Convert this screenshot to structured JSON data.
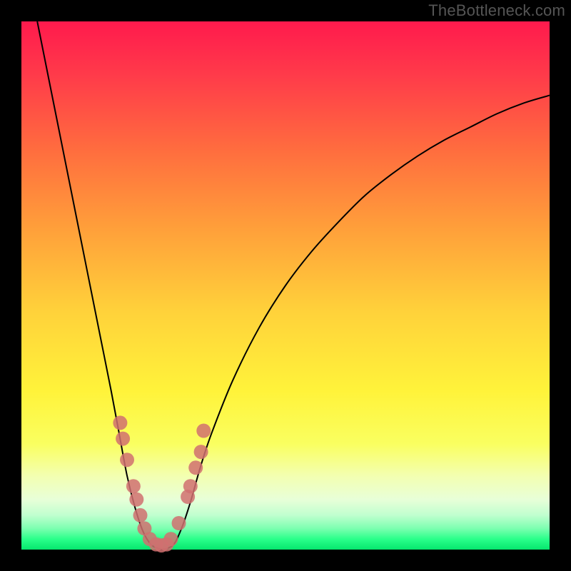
{
  "watermark": "TheBottleneck.com",
  "chart_data": {
    "type": "line",
    "title": "",
    "xlabel": "",
    "ylabel": "",
    "xlim": [
      0,
      100
    ],
    "ylim": [
      0,
      100
    ],
    "background_gradient": {
      "stops": [
        {
          "offset": 0.0,
          "color": "#ff1a4d"
        },
        {
          "offset": 0.1,
          "color": "#ff3a4a"
        },
        {
          "offset": 0.25,
          "color": "#ff6f3e"
        },
        {
          "offset": 0.4,
          "color": "#ffa23a"
        },
        {
          "offset": 0.55,
          "color": "#ffd23a"
        },
        {
          "offset": 0.7,
          "color": "#fff33a"
        },
        {
          "offset": 0.8,
          "color": "#faff60"
        },
        {
          "offset": 0.86,
          "color": "#f3ffb0"
        },
        {
          "offset": 0.905,
          "color": "#e8ffd8"
        },
        {
          "offset": 0.935,
          "color": "#c0ffcf"
        },
        {
          "offset": 0.96,
          "color": "#7cffb0"
        },
        {
          "offset": 0.98,
          "color": "#2aff8a"
        },
        {
          "offset": 1.0,
          "color": "#06e66e"
        }
      ]
    },
    "series": [
      {
        "name": "bottleneck-curve",
        "type": "line",
        "color": "#000000",
        "width": 2,
        "points": [
          {
            "x": 3.0,
            "y": 100.0
          },
          {
            "x": 5.0,
            "y": 90.0
          },
          {
            "x": 7.0,
            "y": 80.0
          },
          {
            "x": 9.0,
            "y": 70.0
          },
          {
            "x": 11.0,
            "y": 60.0
          },
          {
            "x": 13.0,
            "y": 50.0
          },
          {
            "x": 15.0,
            "y": 40.0
          },
          {
            "x": 17.0,
            "y": 30.0
          },
          {
            "x": 18.5,
            "y": 22.0
          },
          {
            "x": 20.0,
            "y": 14.0
          },
          {
            "x": 21.5,
            "y": 8.0
          },
          {
            "x": 23.0,
            "y": 3.5
          },
          {
            "x": 24.5,
            "y": 1.0
          },
          {
            "x": 26.0,
            "y": 0.2
          },
          {
            "x": 27.5,
            "y": 0.2
          },
          {
            "x": 29.0,
            "y": 1.2
          },
          {
            "x": 30.5,
            "y": 4.5
          },
          {
            "x": 32.0,
            "y": 9.0
          },
          {
            "x": 34.0,
            "y": 16.0
          },
          {
            "x": 36.0,
            "y": 22.0
          },
          {
            "x": 40.0,
            "y": 32.0
          },
          {
            "x": 45.0,
            "y": 42.0
          },
          {
            "x": 50.0,
            "y": 50.0
          },
          {
            "x": 55.0,
            "y": 56.5
          },
          {
            "x": 60.0,
            "y": 62.0
          },
          {
            "x": 65.0,
            "y": 67.0
          },
          {
            "x": 70.0,
            "y": 71.0
          },
          {
            "x": 75.0,
            "y": 74.5
          },
          {
            "x": 80.0,
            "y": 77.5
          },
          {
            "x": 85.0,
            "y": 80.0
          },
          {
            "x": 90.0,
            "y": 82.5
          },
          {
            "x": 95.0,
            "y": 84.5
          },
          {
            "x": 100.0,
            "y": 86.0
          }
        ]
      },
      {
        "name": "highlighted-points",
        "type": "scatter",
        "color": "#d07070",
        "radius": 10,
        "points": [
          {
            "x": 18.7,
            "y": 24.0
          },
          {
            "x": 19.2,
            "y": 21.0
          },
          {
            "x": 20.0,
            "y": 17.0
          },
          {
            "x": 21.2,
            "y": 12.0
          },
          {
            "x": 21.8,
            "y": 9.5
          },
          {
            "x": 22.5,
            "y": 6.5
          },
          {
            "x": 23.3,
            "y": 4.0
          },
          {
            "x": 24.3,
            "y": 2.0
          },
          {
            "x": 25.5,
            "y": 1.0
          },
          {
            "x": 26.5,
            "y": 0.8
          },
          {
            "x": 27.5,
            "y": 1.0
          },
          {
            "x": 28.3,
            "y": 2.0
          },
          {
            "x": 29.8,
            "y": 5.0
          },
          {
            "x": 31.5,
            "y": 10.0
          },
          {
            "x": 32.0,
            "y": 12.0
          },
          {
            "x": 33.0,
            "y": 15.5
          },
          {
            "x": 34.0,
            "y": 18.5
          },
          {
            "x": 34.5,
            "y": 22.5
          }
        ]
      }
    ]
  }
}
